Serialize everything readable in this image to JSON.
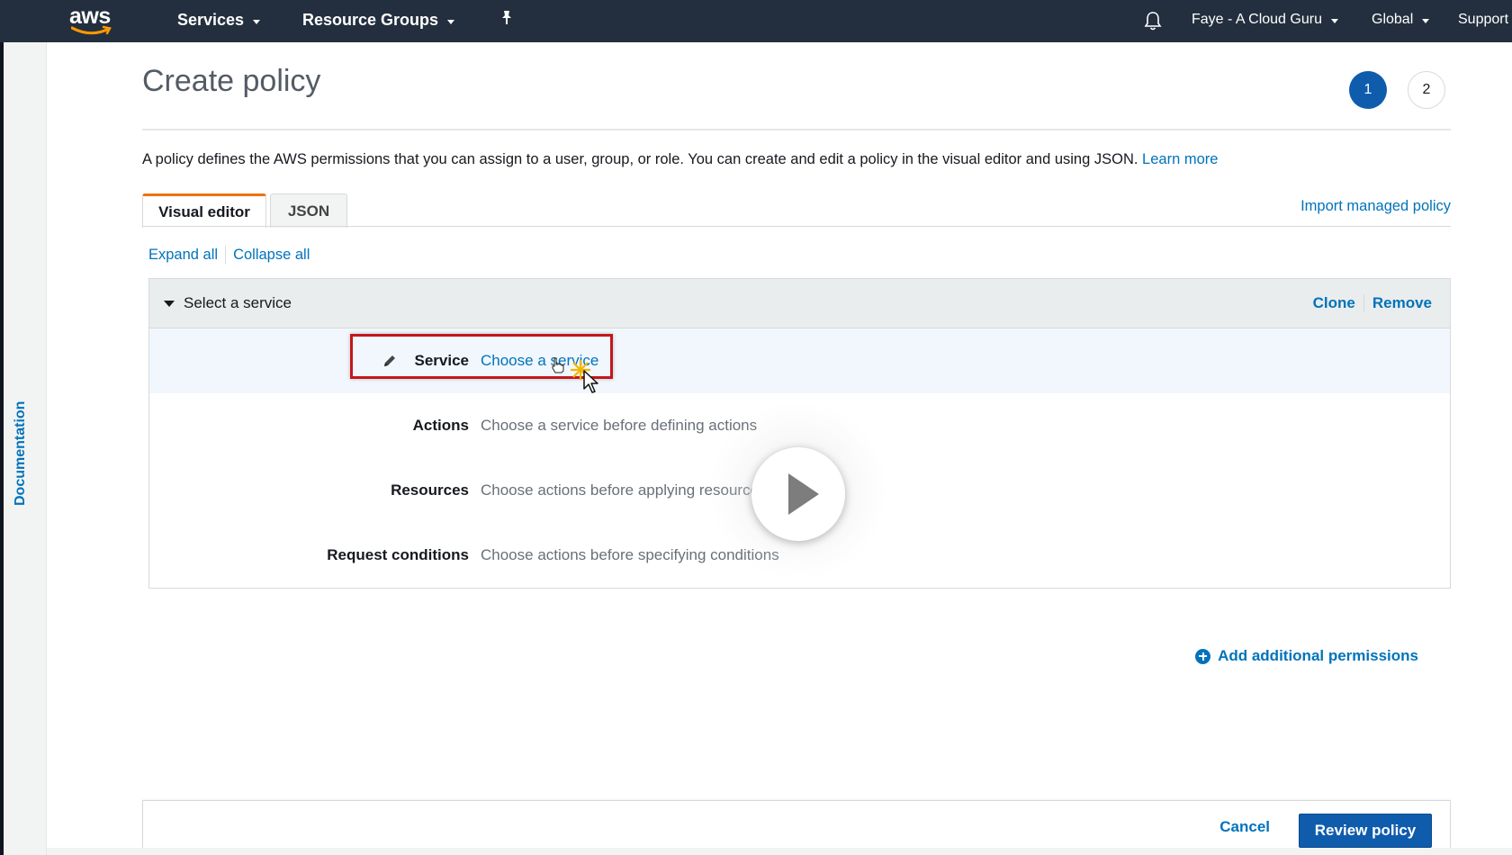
{
  "topnav": {
    "logo_text": "aws",
    "services_label": "Services",
    "resource_groups_label": "Resource Groups",
    "pin_icon": "pushpin-icon",
    "bell_icon": "bell-icon",
    "account_label": "Faye - A Cloud Guru",
    "region_label": "Global",
    "support_label": "Support"
  },
  "sidebar": {
    "documentation_label": "Documentation"
  },
  "page": {
    "title": "Create policy",
    "steps": [
      "1",
      "2"
    ],
    "description": "A policy defines the AWS permissions that you can assign to a user, group, or role. You can create and edit a policy in the visual editor and using JSON.",
    "learn_more": "Learn more"
  },
  "tabs": [
    {
      "label": "Visual editor",
      "active": true
    },
    {
      "label": "JSON",
      "active": false
    }
  ],
  "import_link": "Import managed policy",
  "expand_all": "Expand all",
  "collapse_all": "Collapse all",
  "permission_block": {
    "header": "Select a service",
    "clone": "Clone",
    "remove": "Remove",
    "rows": [
      {
        "label": "Service",
        "value": "Choose a service"
      },
      {
        "label": "Actions",
        "value": "Choose a service before defining actions"
      },
      {
        "label": "Resources",
        "value": "Choose actions before applying resources"
      },
      {
        "label": "Request conditions",
        "value": "Choose actions before specifying conditions"
      }
    ]
  },
  "add_permissions": "Add additional permissions",
  "footer": {
    "cancel": "Cancel",
    "review": "Review policy"
  },
  "colors": {
    "nav_bg": "#232f3e",
    "link": "#0073bb",
    "primary": "#0f5cad",
    "tab_accent": "#ec7211",
    "highlight_border": "#c4161c"
  }
}
